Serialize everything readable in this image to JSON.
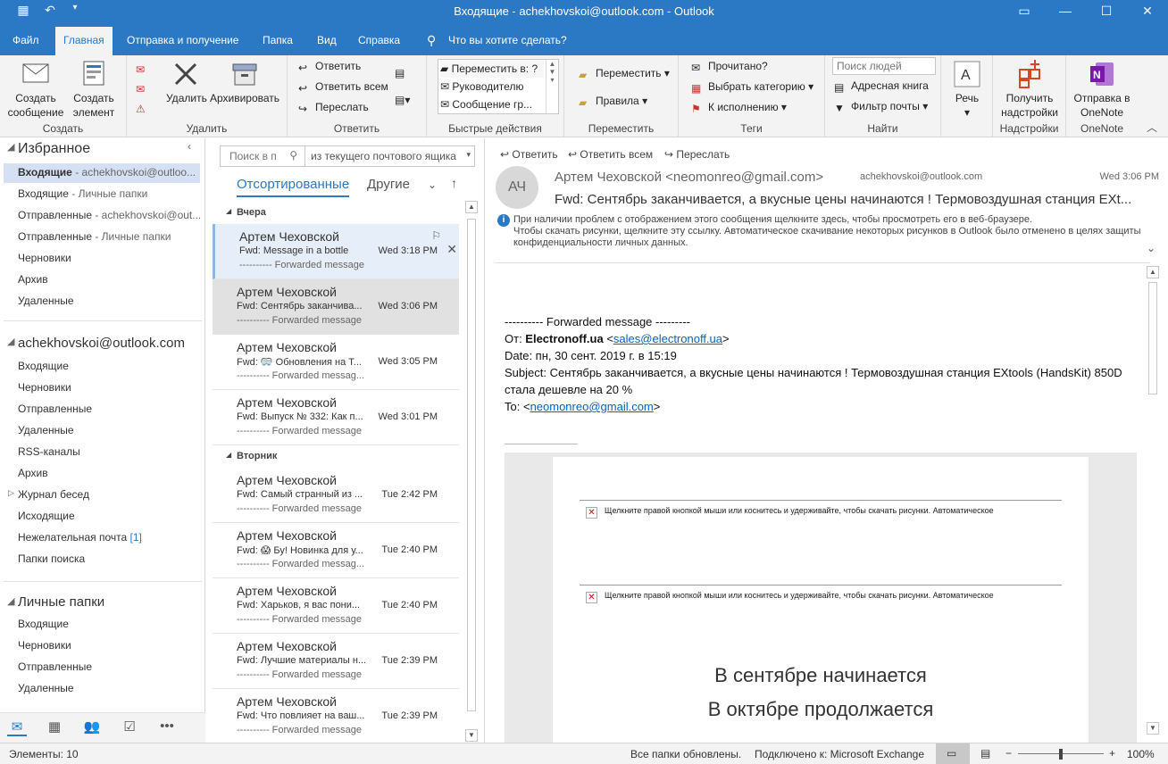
{
  "window": {
    "title": "Входящие - achekhovskoi@outlook.com  -  Outlook"
  },
  "menu": {
    "tabs": [
      "Файл",
      "Главная",
      "Отправка и получение",
      "Папка",
      "Вид",
      "Справка"
    ],
    "tell_me": "Что вы хотите сделать?"
  },
  "ribbon": {
    "create": {
      "new_message": "Создать сообщение",
      "new_item": "Создать элемент",
      "label": "Создать"
    },
    "delete": {
      "delete": "Удалить",
      "archive": "Архивировать",
      "label": "Удалить"
    },
    "respond": {
      "reply": "Ответить",
      "reply_all": "Ответить всем",
      "forward": "Переслать",
      "label": "Ответить"
    },
    "quick_steps": {
      "items": [
        "Переместить в: ?",
        "Руководителю",
        "Сообщение гр..."
      ],
      "label": "Быстрые действия"
    },
    "move": {
      "move": "Переместить",
      "rules": "Правила",
      "label": "Переместить"
    },
    "tags": {
      "read": "Прочитано?",
      "categorize": "Выбрать категорию",
      "followup": "К исполнению",
      "label": "Теги"
    },
    "find": {
      "search_people": "Поиск людей",
      "address_book": "Адресная книга",
      "filter": "Фильтр почты",
      "label": "Найти"
    },
    "speech": {
      "label": "Речь"
    },
    "addins": {
      "get": "Получить надстройки",
      "label": "Надстройки"
    },
    "onenote": {
      "send": "Отправка в OneNote",
      "label": "OneNote"
    }
  },
  "folders": {
    "favorites_title": "Избранное",
    "favorites": [
      {
        "name": "Входящие",
        "sub": " - achekhovskoi@outloo..."
      },
      {
        "name": "Входящие",
        "sub": " - Личные папки"
      },
      {
        "name": "Отправленные",
        "sub": " - achekhovskoi@out..."
      },
      {
        "name": "Отправленные",
        "sub": " - Личные папки"
      },
      {
        "name": "Черновики",
        "sub": ""
      },
      {
        "name": "Архив",
        "sub": ""
      },
      {
        "name": "Удаленные",
        "sub": ""
      }
    ],
    "account_title": "achekhovskoi@outlook.com",
    "account": [
      "Входящие",
      "Черновики",
      "Отправленные",
      "Удаленные",
      "RSS-каналы",
      "Архив",
      "Журнал бесед",
      "Исходящие",
      "Нежелательная почта",
      "Папки поиска"
    ],
    "junk_count": "[1]",
    "personal_title": "Личные папки",
    "personal": [
      "Входящие",
      "Черновики",
      "Отправленные",
      "Удаленные"
    ]
  },
  "list": {
    "search_placeholder": "Поиск в п",
    "scope": "из текущего почтового ящика",
    "tab_focused": "Отсортированные",
    "tab_other": "Другие",
    "group_yesterday": "Вчера",
    "group_tuesday": "Вторник",
    "messages": [
      {
        "from": "Артем Чеховской",
        "subject": "Fwd: Message in a bottle",
        "time": "Wed 3:18 PM",
        "preview": "---------- Forwarded message"
      },
      {
        "from": "Артем Чеховской",
        "subject": "Fwd: Сентябрь заканчива...",
        "time": "Wed 3:06 PM",
        "preview": "---------- Forwarded message"
      },
      {
        "from": "Артем Чеховской",
        "subject": "Fwd: 🥽 Обновления на Т...",
        "time": "Wed 3:05 PM",
        "preview": "---------- Forwarded messag..."
      },
      {
        "from": "Артем Чеховской",
        "subject": "Fwd: Выпуск № 332: Как п...",
        "time": "Wed 3:01 PM",
        "preview": "---------- Forwarded message"
      },
      {
        "from": "Артем Чеховской",
        "subject": "Fwd: Самый странный из ...",
        "time": "Tue 2:42 PM",
        "preview": "---------- Forwarded message"
      },
      {
        "from": "Артем Чеховской",
        "subject": "Fwd: 😱 Бу! Новинка для у...",
        "time": "Tue 2:40 PM",
        "preview": "---------- Forwarded messag..."
      },
      {
        "from": "Артем Чеховской",
        "subject": "Fwd: Харьков, я вас пони...",
        "time": "Tue 2:40 PM",
        "preview": "---------- Forwarded message"
      },
      {
        "from": "Артем Чеховской",
        "subject": "Fwd: Лучшие материалы н...",
        "time": "Tue 2:39 PM",
        "preview": "---------- Forwarded message"
      },
      {
        "from": "Артем Чеховской",
        "subject": "Fwd: Что повлияет на ваш...",
        "time": "Tue 2:39 PM",
        "preview": "---------- Forwarded message"
      }
    ]
  },
  "reading": {
    "actions": {
      "reply": "Ответить",
      "reply_all": "Ответить всем",
      "forward": "Переслать"
    },
    "avatar": "АЧ",
    "from": "Артем Чеховской <neomonreo@gmail.com>",
    "to": "achekhovskoi@outlook.com",
    "date": "Wed 3:06 PM",
    "subject": "Fwd: Сентябрь заканчивается, а вкусные цены начинаются ! Термовоздушная станция EXt...",
    "info1": "При наличии проблем с отображением этого сообщения щелкните здесь, чтобы просмотреть его в веб-браузере.",
    "info2": "Чтобы скачать рисунки, щелкните эту ссылку. Автоматическое скачивание некоторых рисунков в Outlook было отменено в целях защиты конфиденциальности личных данных.",
    "body": {
      "fwd_header": "---------- Forwarded message ---------",
      "from_label": "От: ",
      "from_name": "Electronoff.ua",
      "from_email": "sales@electronoff.ua",
      "date_line": "Date: пн, 30 сент. 2019 г. в 15:19",
      "subject_line": "Subject: Сентябрь заканчивается, а вкусные цены начинаются ! Термовоздушная станция EXtools (HandsKit) 850D стала дешевле на 20 %",
      "to_label": "To: ",
      "to_email": "neomonreo@gmail.com"
    },
    "image_blocked": "Щелкните правой кнопкой мыши или коснитесь и удерживайте, чтобы скачать рисунки. Автоматическое",
    "headline1": "В сентябре начинается",
    "headline2": "В октябре продолжается"
  },
  "status": {
    "items": "Элементы: 10",
    "updated": "Все папки обновлены.",
    "connected": "Подключено к: Microsoft Exchange",
    "zoom": "100%"
  }
}
